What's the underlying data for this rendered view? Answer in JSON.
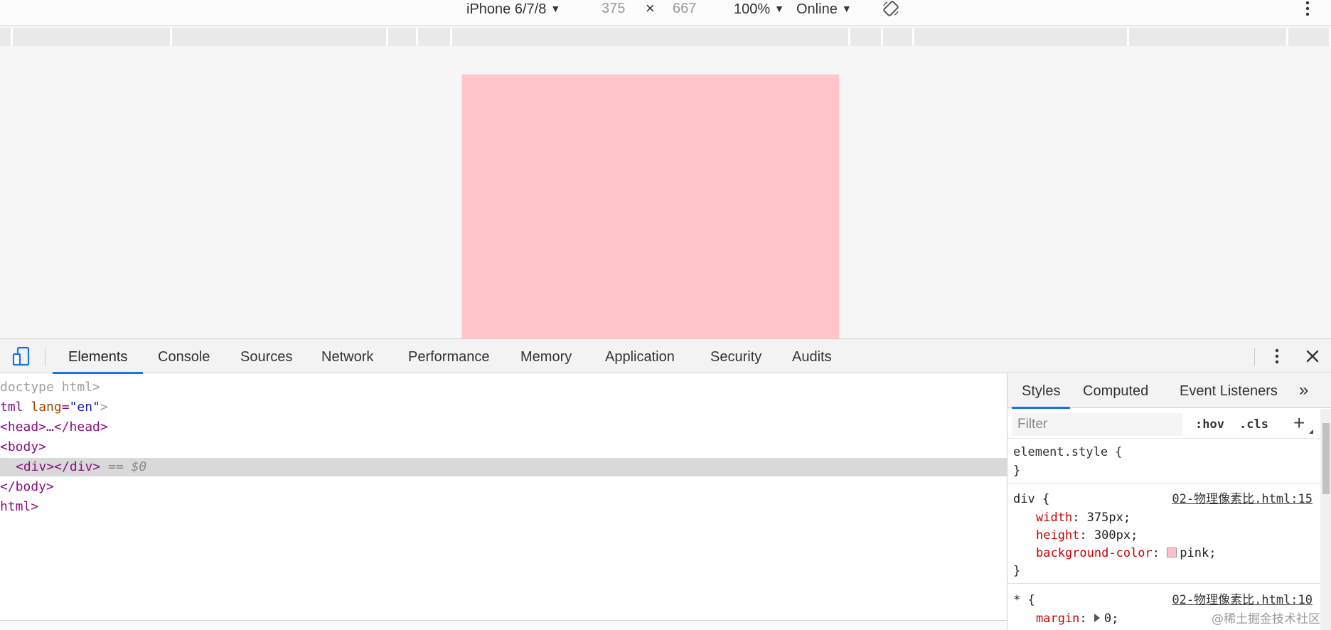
{
  "device_toolbar": {
    "device": "iPhone 6/7/8",
    "width": "375",
    "times": "×",
    "height": "667",
    "zoom": "100%",
    "network": "Online"
  },
  "devtools": {
    "tabs": [
      "Elements",
      "Console",
      "Sources",
      "Network",
      "Performance",
      "Memory",
      "Application",
      "Security",
      "Audits"
    ]
  },
  "elements": {
    "lines": [
      "doctype html>",
      "tml lang=\"en\">",
      "<head>…</head>",
      "<body>",
      "<div></div>",
      "== $0",
      "</body>",
      "html>"
    ]
  },
  "styles_pane": {
    "tabs": [
      "Styles",
      "Computed",
      "Event Listeners"
    ],
    "more": "»",
    "filter_placeholder": "Filter",
    "hov": ":hov",
    "cls": ".cls",
    "plus": "+",
    "element_style_open": "element.style {",
    "close_brace": "}",
    "div_rule": {
      "selector": "div {",
      "source": "02-物理像素比.html:15",
      "props": [
        {
          "name": "width",
          "value": "375px;"
        },
        {
          "name": "height",
          "value": "300px;"
        },
        {
          "name": "background-color",
          "value": "pink;"
        }
      ]
    },
    "star_rule": {
      "selector": "* {",
      "source": "02-物理像素比.html:10",
      "props": [
        {
          "name": "margin",
          "value": "0;"
        }
      ]
    }
  },
  "colors": {
    "pink_box": "#ffc5c8",
    "accent": "#1a73e8"
  },
  "watermark": "@稀土掘金技术社区"
}
